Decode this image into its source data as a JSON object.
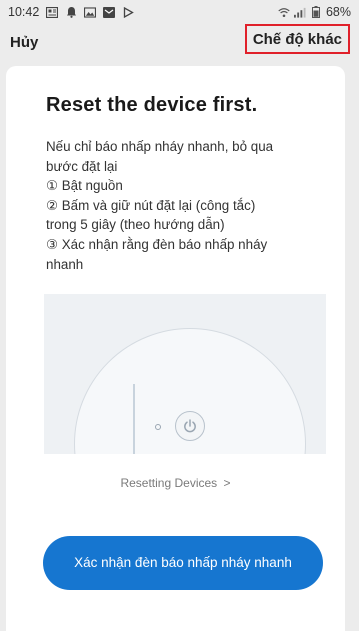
{
  "status_bar": {
    "time": "10:42",
    "battery": "68%",
    "icons": [
      "news-icon",
      "notification-bell-icon",
      "gallery-icon",
      "mail-icon",
      "play-icon",
      "wifi-icon",
      "signal-icon",
      "battery-icon"
    ]
  },
  "header": {
    "cancel_label": "Hủy",
    "other_mode_label": "Chế độ khác",
    "highlight_color": "#e0202a"
  },
  "card": {
    "title": "Reset the device first.",
    "instructions": [
      "Nếu chỉ báo nhấp nháy nhanh, bỏ qua",
      "bước đặt lại",
      "① Bật nguồn",
      "② Bấm và giữ nút đặt lại (công tắc)",
      "trong 5 giây (theo hướng dẫn)",
      "③ Xác nhận rằng đèn báo nhấp nháy",
      "nhanh"
    ],
    "resetting_link_label": "Resetting Devices",
    "resetting_link_chevron": ">",
    "confirm_button_label": "Xác nhận đèn báo nhấp nháy nhanh",
    "accent_color": "#1676d0"
  }
}
